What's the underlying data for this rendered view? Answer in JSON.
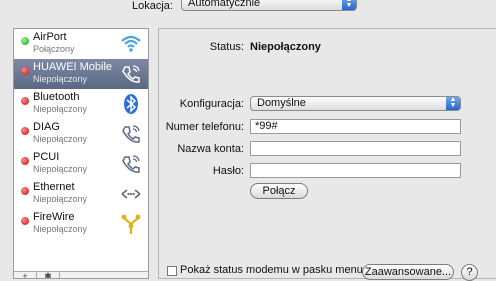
{
  "toolbar": {
    "location_label": "Lokacja:",
    "location_value": "Automatycznie"
  },
  "services": [
    {
      "name": "AirPort",
      "status": "Połączony",
      "dot": "green",
      "icon": "wifi-icon",
      "selected": false
    },
    {
      "name": "HUAWEI Mobile",
      "status": "Niepołączony",
      "dot": "red",
      "icon": "phone-icon",
      "selected": true
    },
    {
      "name": "Bluetooth",
      "status": "Niepołączony",
      "dot": "red",
      "icon": "bluetooth-icon",
      "selected": false
    },
    {
      "name": "DIAG",
      "status": "Niepołączony",
      "dot": "red",
      "icon": "phone-icon",
      "selected": false
    },
    {
      "name": "PCUI",
      "status": "Niepołączony",
      "dot": "red",
      "icon": "phone-icon",
      "selected": false
    },
    {
      "name": "Ethernet",
      "status": "Niepołączony",
      "dot": "red",
      "icon": "ethernet-icon",
      "selected": false
    },
    {
      "name": "FireWire",
      "status": "Niepołączony",
      "dot": "red",
      "icon": "firewire-icon",
      "selected": false
    }
  ],
  "sidebar_buttons": {
    "add": "+",
    "action": "✱"
  },
  "detail": {
    "status_label": "Status:",
    "status_value": "Niepołączony",
    "config_label": "Konfiguracja:",
    "config_value": "Domyślne",
    "phone_label": "Numer telefonu:",
    "phone_value": "*99#",
    "account_label": "Nazwa konta:",
    "account_value": "",
    "password_label": "Hasło:",
    "password_value": "",
    "connect_button": "Połącz",
    "modem_checkbox_label": "Pokaż status modemu w pasku menu",
    "advanced_button": "Zaawansowane...",
    "help_button": "?"
  },
  "colors": {
    "selection": "#6b7896",
    "connected": "#1c9d1c",
    "disconnected": "#c21010",
    "accent": "#2a66cc"
  }
}
